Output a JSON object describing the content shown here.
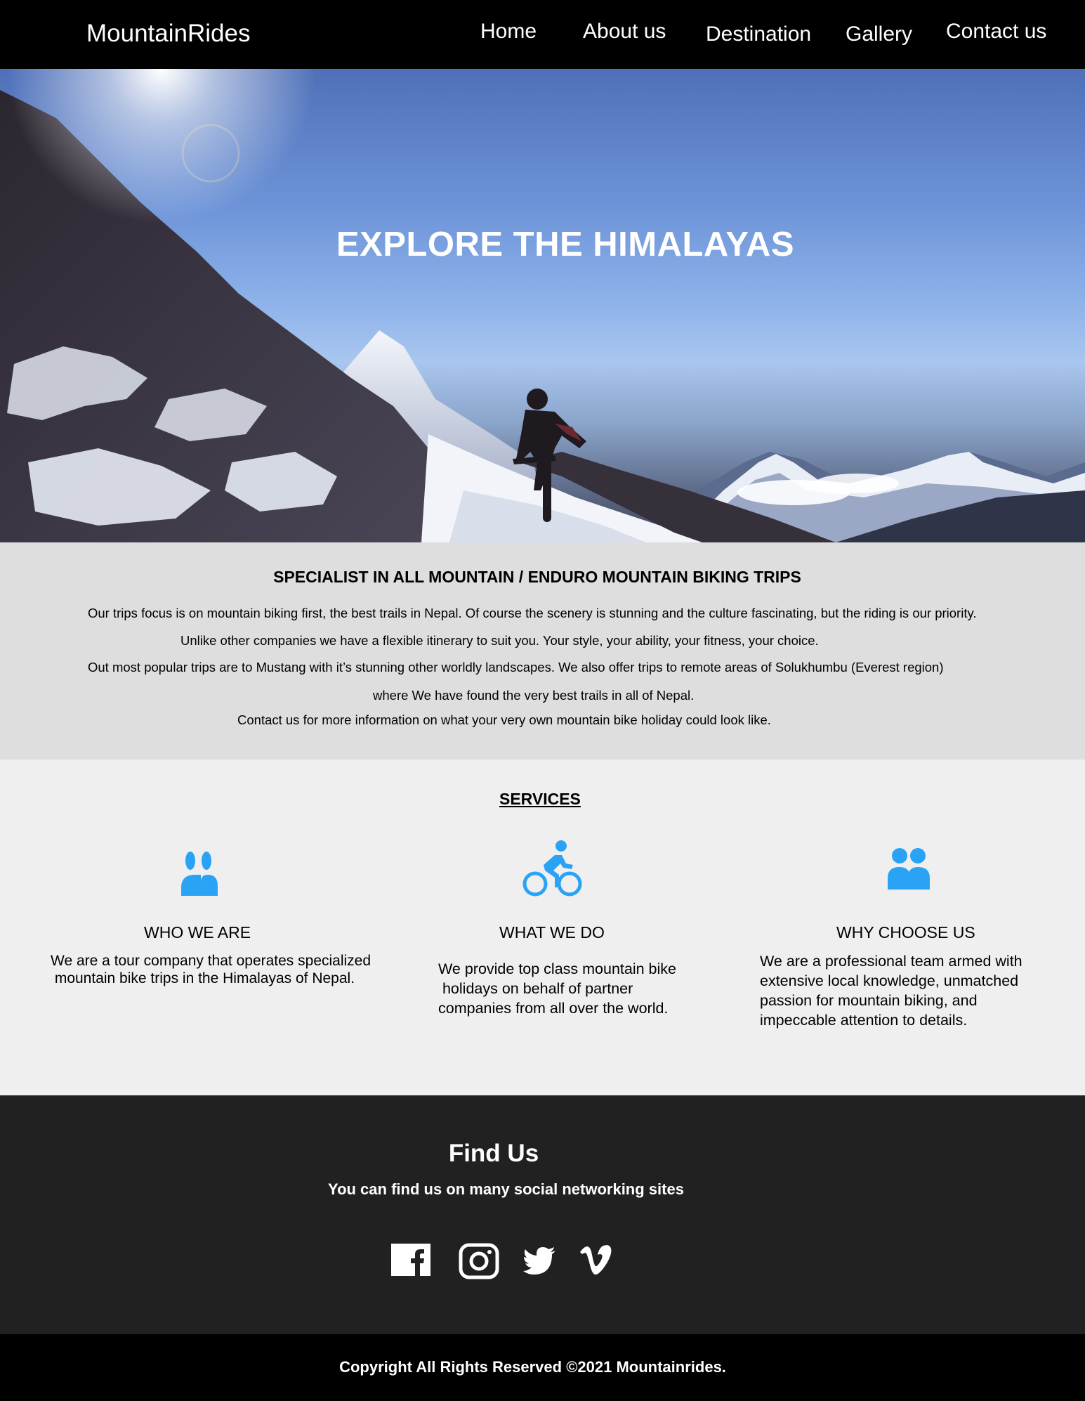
{
  "nav": {
    "brand": "MountainRides",
    "items": [
      {
        "label": "Home"
      },
      {
        "label": "About us"
      },
      {
        "label": "Destination"
      },
      {
        "label": "Gallery"
      },
      {
        "label": "Contact us"
      }
    ]
  },
  "hero": {
    "title": "EXPLORE THE HIMALAYAS"
  },
  "specialist": {
    "title": "SPECIALIST IN ALL MOUNTAIN / ENDURO MOUNTAIN BIKING TRIPS",
    "paragraphs": [
      "Our trips focus is on mountain biking first, the best trails in Nepal. Of course the scenery is stunning and the culture fascinating, but the riding is our priority.",
      "Unlike other companies we have a flexible itinerary to suit you. Your style, your ability, your fitness, your choice.",
      "Out most popular trips are to Mustang with it’s stunning other worldly landscapes. We also offer trips to remote areas of Solukhumbu (Everest region)",
      "where We have found the very best trails in all of Nepal.",
      "Contact us for more information on what your very own mountain bike holiday could look like."
    ]
  },
  "services": {
    "title": "SERVICES",
    "accent_color": "#2aa3f5",
    "items": [
      {
        "icon": "people-icon",
        "heading": "WHO WE ARE",
        "text": "We are a tour company that operates specialized\n mountain bike trips in the Himalayas of Nepal."
      },
      {
        "icon": "cyclist-icon",
        "heading": "WHAT WE DO",
        "text": "We provide top class mountain bike\n holidays on behalf of partner\ncompanies from all over the world."
      },
      {
        "icon": "group-icon",
        "heading": "WHY CHOOSE US",
        "text": "We are a professional team armed with\nextensive local knowledge, unmatched\npassion for mountain biking, and\nimpeccable attention to details."
      }
    ]
  },
  "find_us": {
    "title": "Find Us",
    "subtitle": "You can find us on many social networking sites",
    "socials": [
      {
        "icon": "facebook-icon"
      },
      {
        "icon": "instagram-icon"
      },
      {
        "icon": "twitter-icon"
      },
      {
        "icon": "vimeo-icon"
      }
    ]
  },
  "footer": {
    "copyright": "Copyright All Rights Reserved ©2021 Mountainrides."
  }
}
